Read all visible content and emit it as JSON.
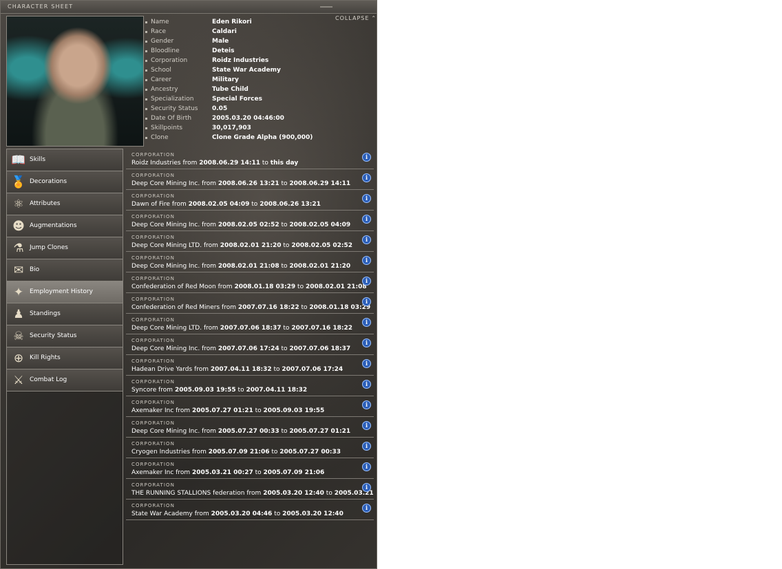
{
  "window": {
    "title": "CHARACTER SHEET",
    "collapse_label": "COLLAPSE"
  },
  "character": [
    {
      "label": "Name",
      "value": "Eden Rikori"
    },
    {
      "label": "Race",
      "value": "Caldari"
    },
    {
      "label": "Gender",
      "value": "Male"
    },
    {
      "label": "Bloodline",
      "value": "Deteis"
    },
    {
      "label": "Corporation",
      "value": "Roidz Industries"
    },
    {
      "label": "School",
      "value": "State War Academy"
    },
    {
      "label": "Career",
      "value": "Military"
    },
    {
      "label": "Ancestry",
      "value": "Tube Child"
    },
    {
      "label": "Specialization",
      "value": "Special Forces"
    },
    {
      "label": "Security Status",
      "value": "0.05"
    },
    {
      "label": "Date Of Birth",
      "value": "2005.03.20 04:46:00"
    },
    {
      "label": "Skillpoints",
      "value": "30,017,903"
    },
    {
      "label": "Clone",
      "value": "Clone Grade Alpha (900,000)"
    }
  ],
  "nav": [
    {
      "label": "Skills",
      "icon": "book-icon",
      "glyph": "📖",
      "active": false
    },
    {
      "label": "Decorations",
      "icon": "medal-icon",
      "glyph": "🏅",
      "active": false
    },
    {
      "label": "Attributes",
      "icon": "atom-icon",
      "glyph": "⚛",
      "active": false
    },
    {
      "label": "Augmentations",
      "icon": "implant-head-icon",
      "glyph": "☻",
      "active": false
    },
    {
      "label": "Jump Clones",
      "icon": "clone-pod-icon",
      "glyph": "⚗",
      "active": false
    },
    {
      "label": "Bio",
      "icon": "document-icon",
      "glyph": "✉",
      "active": false
    },
    {
      "label": "Employment History",
      "icon": "stars-icon",
      "glyph": "✦",
      "active": true
    },
    {
      "label": "Standings",
      "icon": "people-icon",
      "glyph": "♟",
      "active": false
    },
    {
      "label": "Security Status",
      "icon": "skull-icon",
      "glyph": "☠",
      "active": false
    },
    {
      "label": "Kill Rights",
      "icon": "crosshair-icon",
      "glyph": "⊕",
      "active": false
    },
    {
      "label": "Combat Log",
      "icon": "crossed-swords-icon",
      "glyph": "⚔",
      "active": false
    }
  ],
  "employment": {
    "kind_label": "CORPORATION",
    "from_word": "from",
    "to_word": "to",
    "items": [
      {
        "corp": "Roidz Industries",
        "from": "2008.06.29 14:11",
        "to": "this day"
      },
      {
        "corp": "Deep Core Mining Inc.",
        "from": "2008.06.26 13:21",
        "to": "2008.06.29 14:11"
      },
      {
        "corp": "Dawn of Fire",
        "from": "2008.02.05 04:09",
        "to": "2008.06.26 13:21"
      },
      {
        "corp": "Deep Core Mining Inc.",
        "from": "2008.02.05 02:52",
        "to": "2008.02.05 04:09"
      },
      {
        "corp": "Deep Core Mining LTD.",
        "from": "2008.02.01 21:20",
        "to": "2008.02.05 02:52"
      },
      {
        "corp": "Deep Core Mining Inc.",
        "from": "2008.02.01 21:08",
        "to": "2008.02.01 21:20"
      },
      {
        "corp": "Confederation of Red Moon",
        "from": "2008.01.18 03:29",
        "to": "2008.02.01 21:08"
      },
      {
        "corp": "Confederation of Red Miners",
        "from": "2007.07.16 18:22",
        "to": "2008.01.18 03:29"
      },
      {
        "corp": "Deep Core Mining LTD.",
        "from": "2007.07.06 18:37",
        "to": "2007.07.16 18:22"
      },
      {
        "corp": "Deep Core Mining Inc.",
        "from": "2007.07.06 17:24",
        "to": "2007.07.06 18:37"
      },
      {
        "corp": "Hadean Drive Yards",
        "from": "2007.04.11 18:32",
        "to": "2007.07.06 17:24"
      },
      {
        "corp": "Syncore",
        "from": "2005.09.03 19:55",
        "to": "2007.04.11 18:32"
      },
      {
        "corp": "Axemaker Inc",
        "from": "2005.07.27 01:21",
        "to": "2005.09.03 19:55"
      },
      {
        "corp": "Deep Core Mining Inc.",
        "from": "2005.07.27 00:33",
        "to": "2005.07.27 01:21"
      },
      {
        "corp": "Cryogen Industries",
        "from": "2005.07.09 21:06",
        "to": "2005.07.27 00:33"
      },
      {
        "corp": "Axemaker Inc",
        "from": "2005.03.21 00:27",
        "to": "2005.07.09 21:06"
      },
      {
        "corp": "THE RUNNING STALLIONS federation",
        "from": "2005.03.20 12:40",
        "to": "2005.03.21"
      },
      {
        "corp": "State War Academy",
        "from": "2005.03.20 04:46",
        "to": "2005.03.20 12:40"
      }
    ]
  },
  "colors": {
    "active_nav": "#7c7872",
    "info_icon": "#2b5eb8"
  }
}
